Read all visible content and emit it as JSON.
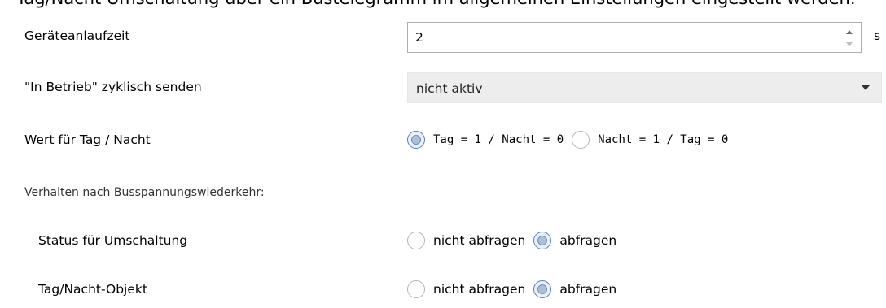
{
  "rows": {
    "startup_time": {
      "label": "Geräteanlaufzeit",
      "value": "2",
      "unit": "s"
    },
    "cyclic_send": {
      "label": "\"In Betrieb\" zyklisch senden",
      "selected": "nicht aktiv"
    },
    "day_night_value": {
      "label": "Wert für Tag / Nacht",
      "options": [
        {
          "label": "Tag = 1 / Nacht = 0",
          "checked": true
        },
        {
          "label": "Nacht = 1 / Tag = 0",
          "checked": false
        }
      ]
    },
    "section_heading": "Verhalten nach Busspannungswiederkehr:",
    "switch_status": {
      "label": "Status für Umschaltung",
      "options": [
        {
          "label": "nicht abfragen",
          "checked": false
        },
        {
          "label": "abfragen",
          "checked": true
        }
      ]
    },
    "day_night_object": {
      "label": "Tag/Nacht-Objekt",
      "options": [
        {
          "label": "nicht abfragen",
          "checked": false
        },
        {
          "label": "abfragen",
          "checked": true
        }
      ]
    }
  }
}
